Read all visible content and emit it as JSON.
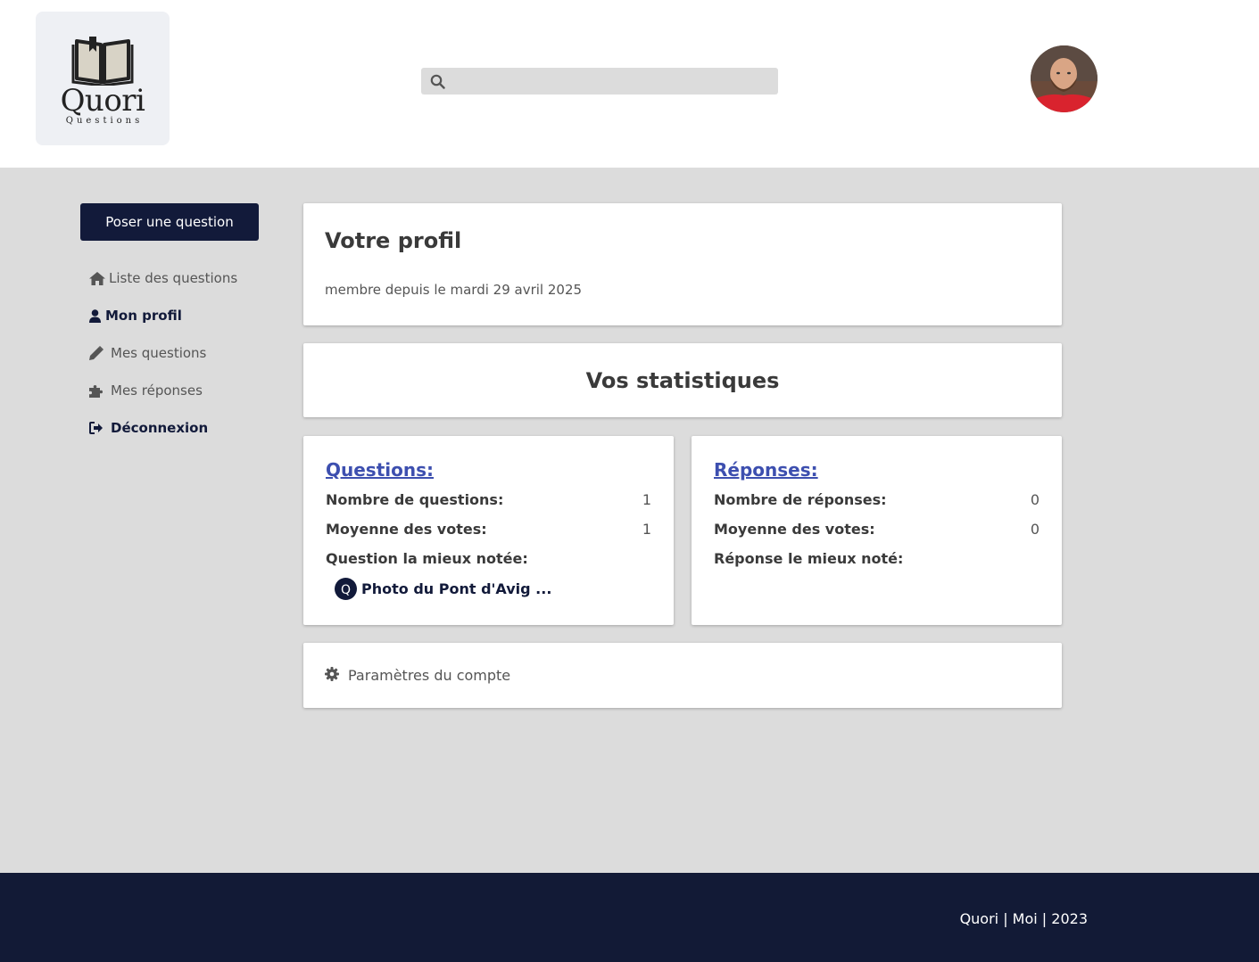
{
  "header": {
    "logo": {
      "title": "Quori",
      "subtitle": "Questions"
    },
    "search": {
      "placeholder": "",
      "value": ""
    }
  },
  "sidebar": {
    "ask_button": "Poser une question",
    "items": [
      {
        "label": "Liste des questions",
        "icon": "home-icon"
      },
      {
        "label": "Mon profil",
        "icon": "user-icon",
        "active": true
      },
      {
        "label": "Mes questions",
        "icon": "pencil-icon"
      },
      {
        "label": "Mes réponses",
        "icon": "puzzle-icon"
      },
      {
        "label": "Déconnexion",
        "icon": "logout-icon"
      }
    ]
  },
  "profile": {
    "title": "Votre profil",
    "member_since": "membre depuis le mardi 29 avril 2025"
  },
  "stats": {
    "title": "Vos statistiques",
    "questions": {
      "title": "Questions:",
      "count_label": "Nombre de questions:",
      "count": "1",
      "avg_label": "Moyenne des votes:",
      "avg": "1",
      "best_label": "Question la mieux notée:",
      "best_badge": "Q",
      "best_title": "Photo du Pont d'Avig ..."
    },
    "answers": {
      "title": "Réponses:",
      "count_label": "Nombre de réponses:",
      "count": "0",
      "avg_label": "Moyenne des votes:",
      "avg": "0",
      "best_label": "Réponse le mieux noté:"
    }
  },
  "settings": {
    "label": "Paramètres du compte",
    "icon": "gear-icon"
  },
  "footer": {
    "text": "Quori | Moi | 2023"
  },
  "colors": {
    "navy": "#121a3a",
    "link": "#3d4faf",
    "background": "#dcdcdc"
  }
}
